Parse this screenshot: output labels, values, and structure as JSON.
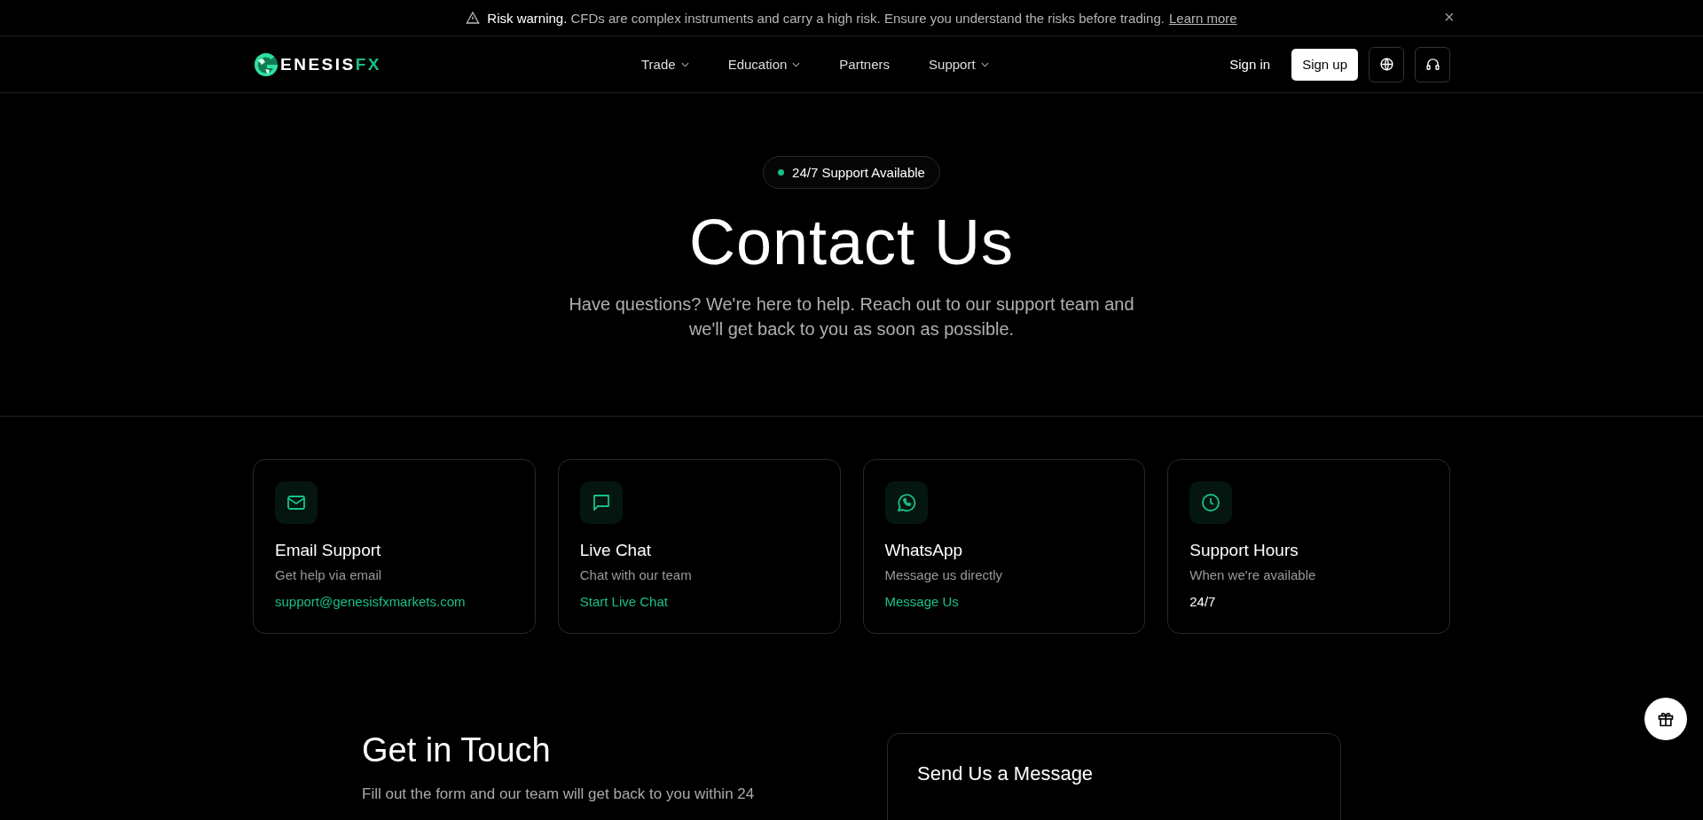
{
  "risk_banner": {
    "label": "Risk warning.",
    "message": "CFDs are complex instruments and carry a high risk. Ensure you understand the risks before trading.",
    "link": "Learn more",
    "close": "×"
  },
  "nav": {
    "logo": {
      "text": "ENESIS",
      "accent": "FX"
    },
    "items": [
      {
        "label": "Trade",
        "dropdown": true
      },
      {
        "label": "Education",
        "dropdown": true
      },
      {
        "label": "Partners",
        "dropdown": false
      },
      {
        "label": "Support",
        "dropdown": true
      }
    ],
    "sign_in": "Sign in",
    "sign_up": "Sign up"
  },
  "hero": {
    "badge": "24/7 Support Available",
    "title": "Contact Us",
    "subtitle": "Have questions? We're here to help. Reach out to our support team and we'll get back to you as soon as possible."
  },
  "cards": [
    {
      "kind": "mail",
      "title": "Email Support",
      "description": "Get help via email",
      "value": "support@genesisfxmarkets.com",
      "link": true
    },
    {
      "kind": "chat",
      "title": "Live Chat",
      "description": "Chat with our team",
      "value": "Start Live Chat",
      "link": true
    },
    {
      "kind": "whatsapp",
      "title": "WhatsApp",
      "description": "Message us directly",
      "value": "Message Us",
      "link": true
    },
    {
      "kind": "clock",
      "title": "Support Hours",
      "description": "When we're available",
      "value": "24/7",
      "link": false
    }
  ],
  "get_in_touch": {
    "title": "Get in Touch",
    "text": "Fill out the form and our team will get back to you within 24"
  },
  "form": {
    "title": "Send Us a Message"
  }
}
